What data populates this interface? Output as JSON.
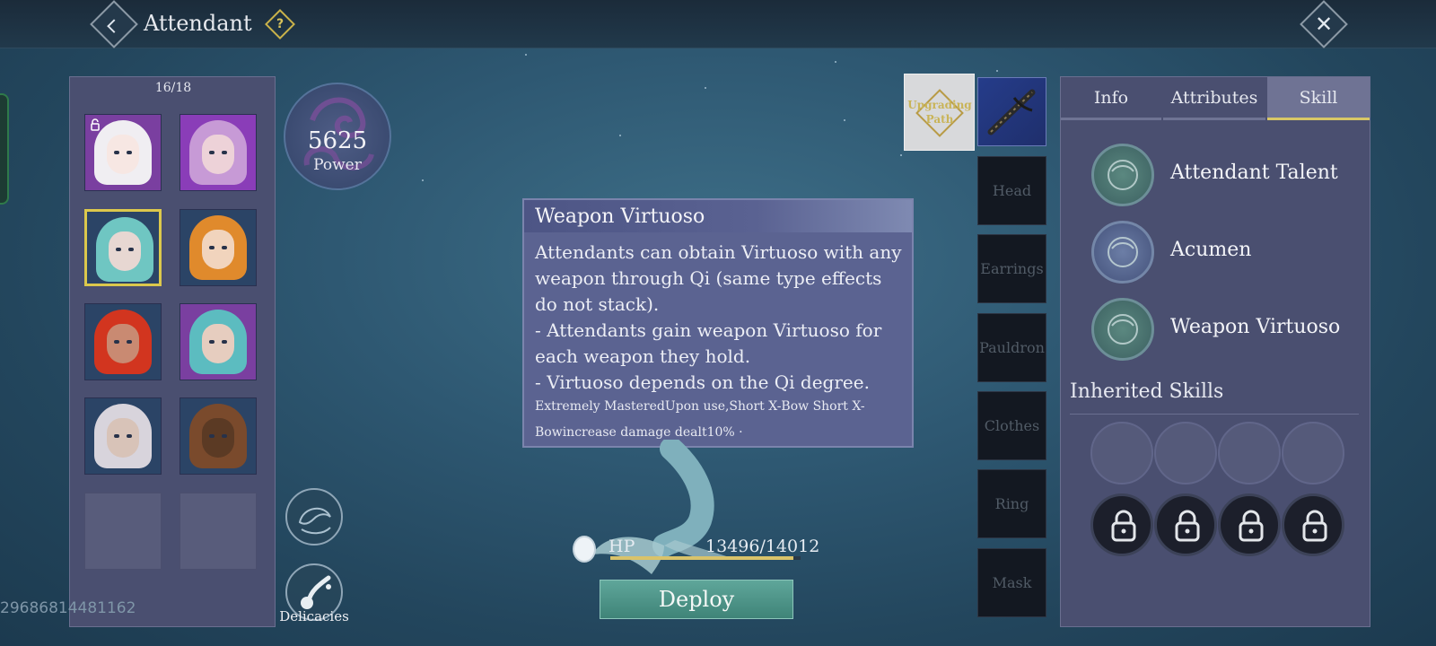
{
  "header": {
    "title": "Attendant",
    "help_glyph": "?",
    "close_glyph": "✕"
  },
  "roster": {
    "count": "16/18",
    "slots": [
      {
        "kind": "portrait",
        "hair": "#f0eef2",
        "face": "#f7e7e3",
        "bg": "#7a3fa0",
        "locked": true
      },
      {
        "kind": "portrait",
        "hair": "#c79ad6",
        "face": "#edd2d8",
        "bg": "#8a3db8"
      },
      {
        "kind": "portrait",
        "hair": "#6fc6c2",
        "face": "#e7d7d2",
        "bg": "#2b4466",
        "selected": true
      },
      {
        "kind": "portrait",
        "hair": "#e08a2c",
        "face": "#f1d4bd",
        "bg": "#2b4466"
      },
      {
        "kind": "portrait",
        "hair": "#d2351f",
        "face": "#c98a72",
        "bg": "#2b4466"
      },
      {
        "kind": "portrait",
        "hair": "#5cbcc0",
        "face": "#e6cdbf",
        "bg": "#7a3fa0"
      },
      {
        "kind": "portrait",
        "hair": "#d8d4dc",
        "face": "#d8c3b8",
        "bg": "#2b4466"
      },
      {
        "kind": "portrait",
        "hair": "#7a4a2c",
        "face": "#5b3a24",
        "bg": "#2b4466"
      },
      {
        "kind": "empty"
      },
      {
        "kind": "empty"
      }
    ]
  },
  "power": {
    "value": "5625",
    "label": "Power"
  },
  "delicacies_label": "Delicacies",
  "player_id": "29686814481162",
  "tooltip": {
    "title": "Weapon Virtuoso",
    "body": "Attendants can obtain Virtuoso with any weapon through Qi (same type effects do not stack).\n- Attendants gain weapon Virtuoso for each weapon they hold.\n- Virtuoso depends on the Qi degree.",
    "note": " Extremely MasteredUpon use,Short X-Bow Short X-Bowincrease damage dealt10% ·"
  },
  "hp": {
    "label": "HP",
    "value": "13496/14012",
    "current": 13496,
    "max": 14012
  },
  "deploy_label": "Deploy",
  "equipment": {
    "upgrading_path": "Upgrading Path",
    "slots": [
      "Head",
      "Earrings",
      "Pauldron",
      "Clothes",
      "Ring",
      "Mask"
    ]
  },
  "panel": {
    "tabs": [
      "Info",
      "Attributes",
      "Skill"
    ],
    "active_tab": "Skill",
    "skills": [
      {
        "name": "Attendant Talent",
        "icon": "talent-icon"
      },
      {
        "name": "Acumen",
        "icon": "acumen-icon"
      },
      {
        "name": "Weapon Virtuoso",
        "icon": "weapon-virtuoso-icon"
      }
    ],
    "inherited_title": "Inherited Skills",
    "inherited_open_slots": 4,
    "inherited_locked_slots": 4
  },
  "colors": {
    "accent_gold": "#d8c866",
    "panel_bg": "#4a4f70",
    "deploy_green": "#4f978a"
  }
}
